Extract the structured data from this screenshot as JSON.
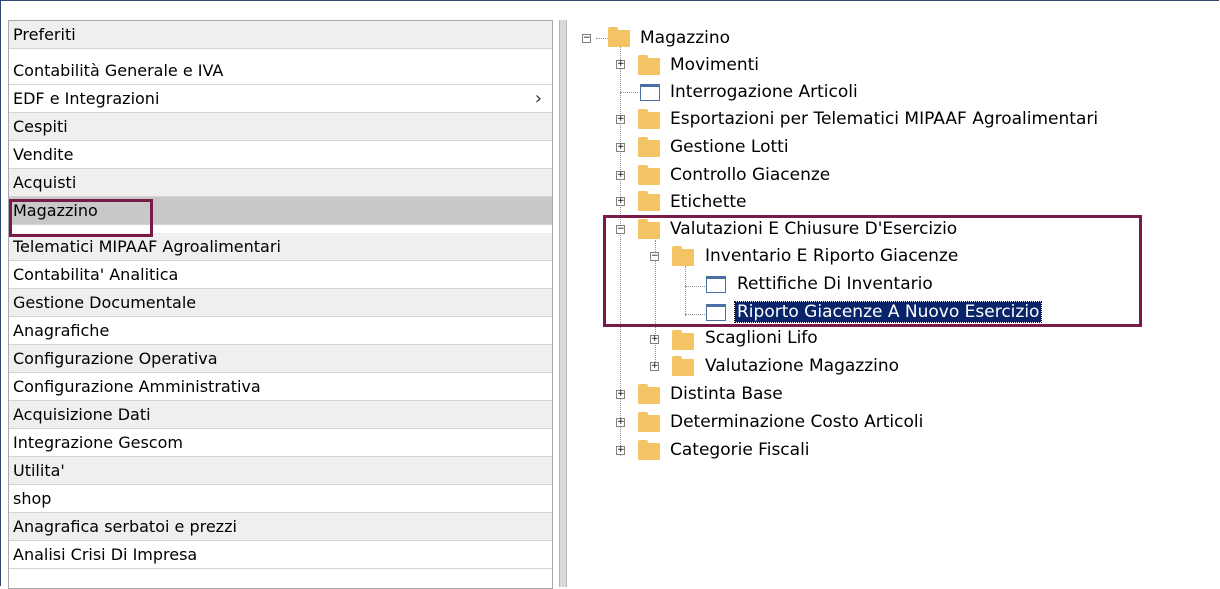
{
  "menu": {
    "items": [
      {
        "label": "Preferiti"
      },
      {
        "label": "Contabilità Generale e IVA"
      },
      {
        "label": "EDF e Integrazioni",
        "chevron": "›"
      },
      {
        "label": "Cespiti"
      },
      {
        "label": "Vendite"
      },
      {
        "label": "Acquisti"
      },
      {
        "label": "Magazzino",
        "selected": true
      },
      {
        "label": "Telematici MIPAAF Agroalimentari"
      },
      {
        "label": "Contabilita' Analitica"
      },
      {
        "label": "Gestione Documentale"
      },
      {
        "label": "Anagrafiche"
      },
      {
        "label": "Configurazione Operativa"
      },
      {
        "label": "Configurazione Amministrativa"
      },
      {
        "label": "Acquisizione Dati"
      },
      {
        "label": "Integrazione Gescom"
      },
      {
        "label": "Utilita'"
      },
      {
        "label": "shop"
      },
      {
        "label": "Anagrafica serbatoi e prezzi"
      },
      {
        "label": "Analisi Crisi Di Impresa"
      }
    ]
  },
  "tree": {
    "root": "Magazzino",
    "nodes": [
      {
        "label": "Movimenti",
        "icon": "folder-icon",
        "expander": "plus"
      },
      {
        "label": "Interrogazione Articoli",
        "icon": "document-icon"
      },
      {
        "label": "Esportazioni per Telematici MIPAAF Agroalimentari",
        "icon": "folder-icon",
        "expander": "plus"
      },
      {
        "label": "Gestione Lotti",
        "icon": "folder-icon",
        "expander": "plus"
      },
      {
        "label": "Controllo Giacenze",
        "icon": "folder-icon",
        "expander": "plus"
      },
      {
        "label": "Etichette",
        "icon": "folder-icon",
        "expander": "plus"
      },
      {
        "label": "Valutazioni E Chiusure D'Esercizio",
        "icon": "folder-icon",
        "expander": "minus"
      },
      {
        "label": "Inventario E Riporto Giacenze",
        "icon": "folder-icon",
        "expander": "minus"
      },
      {
        "label": "Rettifiche Di Inventario",
        "icon": "document-icon"
      },
      {
        "label": "Riporto Giacenze A Nuovo Esercizio",
        "icon": "document-icon",
        "selected": true
      },
      {
        "label": "Scaglioni Lifo",
        "icon": "folder-icon",
        "expander": "plus"
      },
      {
        "label": "Valutazione Magazzino",
        "icon": "folder-icon",
        "expander": "plus"
      },
      {
        "label": "Distinta Base",
        "icon": "folder-icon",
        "expander": "plus"
      },
      {
        "label": "Determinazione Costo Articoli",
        "icon": "folder-icon",
        "expander": "plus"
      },
      {
        "label": "Categorie Fiscali",
        "icon": "folder-icon",
        "expander": "plus"
      }
    ]
  },
  "colors": {
    "highlight_border": "#7a1a48",
    "selection_bg": "#0a246a",
    "folder": "#f4c464"
  }
}
